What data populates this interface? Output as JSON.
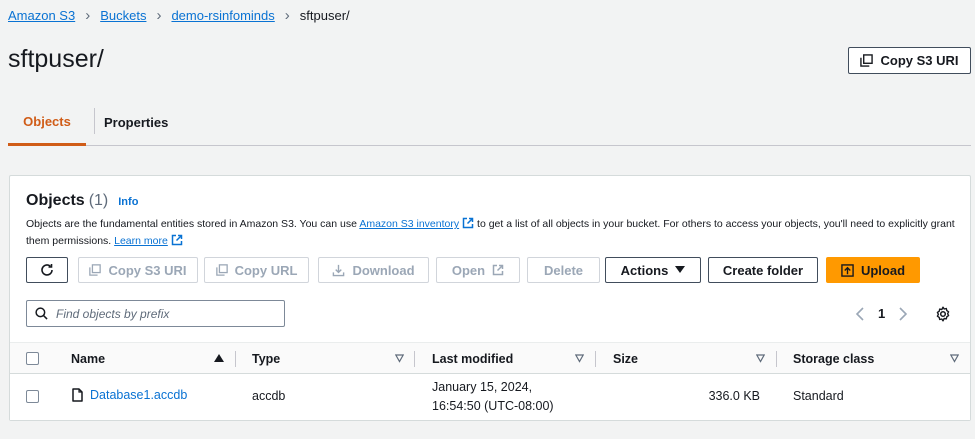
{
  "breadcrumb": {
    "items": [
      "Amazon S3",
      "Buckets",
      "demo-rsinfominds"
    ],
    "current": "sftpuser/"
  },
  "page": {
    "title": "sftpuser/",
    "copy_uri_label": "Copy S3 URI"
  },
  "tabs": [
    {
      "label": "Objects",
      "active": true
    },
    {
      "label": "Properties",
      "active": false
    }
  ],
  "objects_panel": {
    "title": "Objects",
    "count": "(1)",
    "info_label": "Info",
    "description_part1": "Objects are the fundamental entities stored in Amazon S3. You can use ",
    "inventory_link": "Amazon S3 inventory",
    "description_part2": " to get a list of all objects in your bucket. For others to access your objects, you'll need to explicitly grant them permissions. ",
    "learn_more": "Learn more"
  },
  "toolbar": {
    "copy_s3_uri": "Copy S3 URI",
    "copy_url": "Copy URL",
    "download": "Download",
    "open": "Open",
    "delete": "Delete",
    "actions": "Actions",
    "create_folder": "Create folder",
    "upload": "Upload"
  },
  "search": {
    "placeholder": "Find objects by prefix"
  },
  "pagination": {
    "current_page": "1"
  },
  "table": {
    "columns": [
      "Name",
      "Type",
      "Last modified",
      "Size",
      "Storage class"
    ],
    "rows": [
      {
        "name": "Database1.accdb",
        "type": "accdb",
        "last_modified_line1": "January 15, 2024,",
        "last_modified_line2": "16:54:50 (UTC-08:00)",
        "size": "336.0 KB",
        "storage_class": "Standard"
      }
    ]
  },
  "colors": {
    "accent": "#d05c17",
    "link": "#0972d3",
    "primary_button": "#ff9900"
  }
}
